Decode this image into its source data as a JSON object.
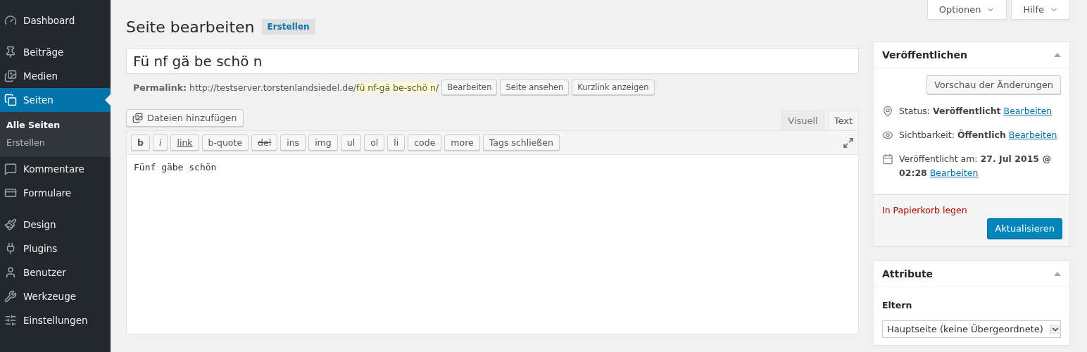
{
  "sidebar": {
    "groups": [
      [
        {
          "label": "Dashboard",
          "selected": false
        }
      ],
      [
        {
          "label": "Beiträge",
          "selected": false
        },
        {
          "label": "Medien",
          "selected": false
        },
        {
          "label": "Seiten",
          "selected": true,
          "children": [
            {
              "label": "Alle Seiten",
              "selected": true
            },
            {
              "label": "Erstellen",
              "selected": false
            }
          ]
        },
        {
          "label": "Kommentare",
          "selected": false
        },
        {
          "label": "Formulare",
          "selected": false
        }
      ],
      [
        {
          "label": "Design",
          "selected": false
        },
        {
          "label": "Plugins",
          "selected": false
        },
        {
          "label": "Benutzer",
          "selected": false
        },
        {
          "label": "Werkzeuge",
          "selected": false
        },
        {
          "label": "Einstellungen",
          "selected": false
        }
      ]
    ]
  },
  "header": {
    "title": "Seite bearbeiten",
    "add_button": "Erstellen",
    "screen_options": "Optionen",
    "help": "Hilfe"
  },
  "post_title": "Fü nf gä be schö n",
  "permalink": {
    "label": "Permalink:",
    "base": "http://testserver.torstenlandsiedel.de/",
    "slug": "fü nf-gä be-schö n",
    "suffix": "/",
    "buttons": [
      "Bearbeiten",
      "Seite ansehen",
      "Kurzlink anzeigen"
    ]
  },
  "media_button": "Dateien hinzufügen",
  "editor_tabs": [
    {
      "label": "Visuell",
      "selected": false
    },
    {
      "label": "Text",
      "selected": true
    }
  ],
  "quicktags": [
    {
      "label": "b",
      "kind": "bold"
    },
    {
      "label": "i",
      "kind": "italic"
    },
    {
      "label": "link",
      "kind": "underline"
    },
    {
      "label": "b-quote",
      "kind": "plain"
    },
    {
      "label": "del",
      "kind": "strike"
    },
    {
      "label": "ins",
      "kind": "plain"
    },
    {
      "label": "img",
      "kind": "plain"
    },
    {
      "label": "ul",
      "kind": "plain"
    },
    {
      "label": "ol",
      "kind": "plain"
    },
    {
      "label": "li",
      "kind": "plain"
    },
    {
      "label": "code",
      "kind": "plain"
    },
    {
      "label": "more",
      "kind": "plain"
    },
    {
      "label": "Tags schließen",
      "kind": "plain"
    }
  ],
  "content": "Fünf gäbe schön",
  "publish": {
    "title": "Veröffentlichen",
    "preview_button": "Vorschau der Änderungen",
    "rows": [
      {
        "label": "Status:",
        "value": "Veröffentlicht",
        "link": "Bearbeiten"
      },
      {
        "label": "Sichtbarkeit:",
        "value": "Öffentlich",
        "link": "Bearbeiten"
      },
      {
        "label": "Veröffentlicht am:",
        "value": "27. Jul 2015 @ 02:28",
        "link": "Bearbeiten"
      }
    ],
    "trash": "In Papierkorb legen",
    "update_button": "Aktualisieren"
  },
  "attributes": {
    "title": "Attribute",
    "parent_label": "Eltern",
    "parent_value": "Hauptseite (keine Übergeordnete)"
  }
}
